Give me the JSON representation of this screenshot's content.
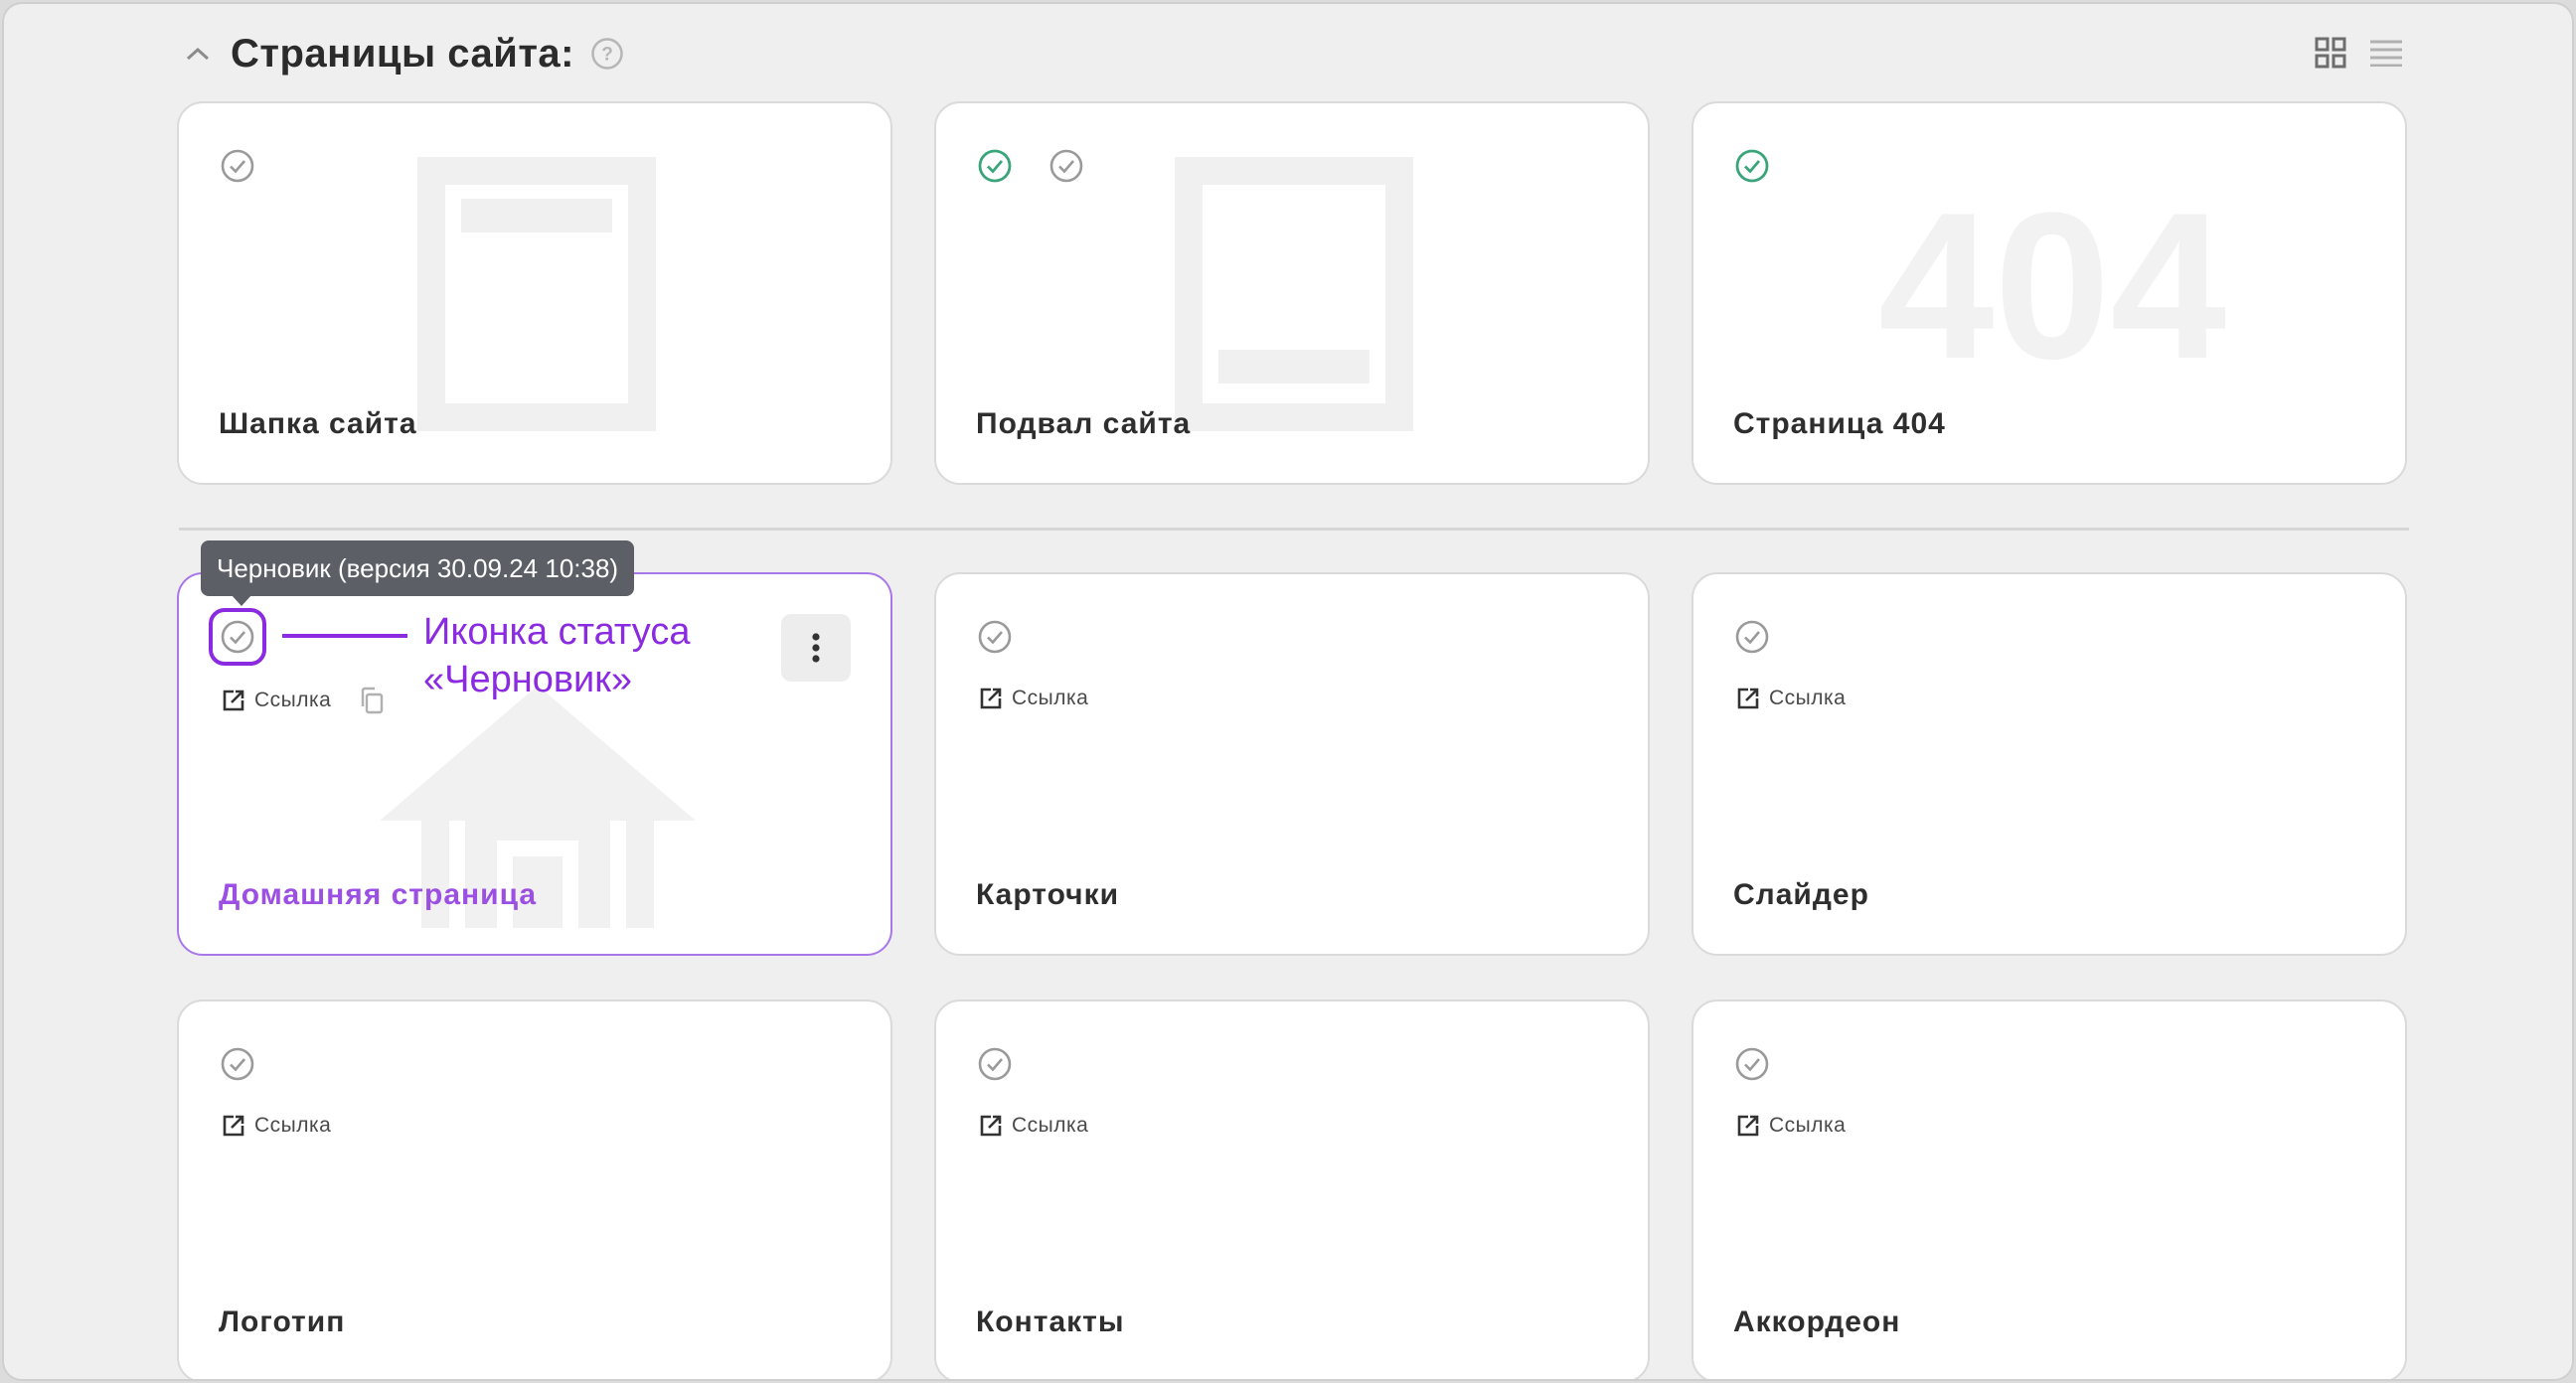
{
  "header": {
    "title": "Страницы сайта:",
    "collapse_icon": "chevron-up-icon",
    "help_icon": "question-circle-icon",
    "view_toggles": [
      "grid-view-icon",
      "list-view-icon"
    ]
  },
  "system_cards": [
    {
      "title": "Шапка сайта",
      "statuses": [
        "draft"
      ],
      "watermark": "header-template"
    },
    {
      "title": "Подвал сайта",
      "statuses": [
        "published",
        "draft"
      ],
      "watermark": "footer-template"
    },
    {
      "title": "Страница 404",
      "statuses": [
        "published"
      ],
      "watermark": "404"
    }
  ],
  "page_cards": [
    {
      "title": "Домашняя страница",
      "link_label": "Ссылка",
      "status": "draft",
      "active": true
    },
    {
      "title": "Карточки",
      "link_label": "Ссылка",
      "status": "draft"
    },
    {
      "title": "Слайдер",
      "link_label": "Ссылка",
      "status": "draft"
    },
    {
      "title": "Логотип",
      "link_label": "Ссылка",
      "status": "draft"
    },
    {
      "title": "Контакты",
      "link_label": "Ссылка",
      "status": "draft"
    },
    {
      "title": "Аккордеон",
      "link_label": "Ссылка",
      "status": "draft"
    }
  ],
  "watermark_404_text": "404",
  "tooltip": {
    "text": "Черновик (версия 30.09.24 10:38)"
  },
  "annotation": {
    "line1": "Иконка статуса",
    "line2": "«Черновик»"
  },
  "colors": {
    "accent": "#8a2be2",
    "title_active": "#9b4fe3",
    "status_published": "#3aa57a",
    "status_draft": "#9a9a9a",
    "card_bg": "#ffffff",
    "page_bg": "#efefef"
  }
}
